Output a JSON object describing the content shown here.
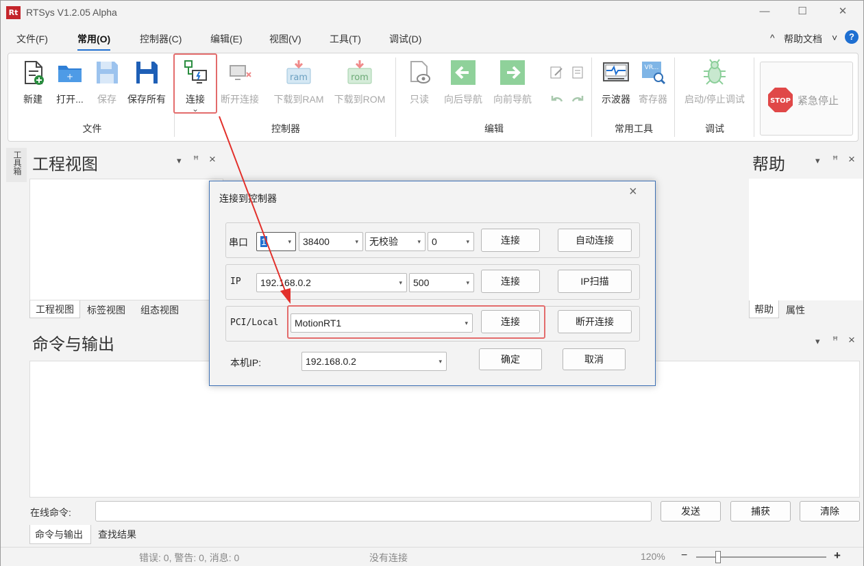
{
  "app": {
    "title": "RTSys V1.2.05 Alpha",
    "logo_text": "Rt"
  },
  "menu": {
    "items": [
      "文件(F)",
      "常用(O)",
      "控制器(C)",
      "编辑(E)",
      "视图(V)",
      "工具(T)",
      "调试(D)"
    ],
    "collapse": "^",
    "help_docs": "帮助文档",
    "help_arrow": "˅",
    "help_icon": "?"
  },
  "ribbon": {
    "file": {
      "group": "文件",
      "new": "新建",
      "open": "打开...",
      "save": "保存",
      "save_all": "保存所有"
    },
    "controller": {
      "group": "控制器",
      "connect": "连接",
      "connect_arrow": "⌄",
      "disconnect": "断开连接",
      "download_ram": "下载到RAM",
      "download_rom": "下载到ROM",
      "ram_label": "ram",
      "rom_label": "rom"
    },
    "edit": {
      "group": "编辑",
      "readonly": "只读",
      "nav_back": "向后导航",
      "nav_forward": "向前导航"
    },
    "tools": {
      "group": "常用工具",
      "oscilloscope": "示波器",
      "register": "寄存器",
      "vr_label": "VR..."
    },
    "debug": {
      "group": "调试",
      "start_stop": "启动/停止调试"
    },
    "emergency": {
      "label": "紧急停止",
      "stop_text": "STOP"
    }
  },
  "left_strip": "工具箱",
  "project": {
    "title": "工程视图",
    "tabs": [
      "工程视图",
      "标签视图",
      "组态视图"
    ]
  },
  "help_panel": {
    "title": "帮助",
    "tabs": [
      "帮助",
      "属性"
    ]
  },
  "output": {
    "title": "命令与输出",
    "online_label": "在线命令:",
    "online_value": "",
    "send": "发送",
    "capture": "捕获",
    "clear": "清除",
    "tabs": [
      "命令与输出",
      "查找结果"
    ]
  },
  "panel_controls": {
    "menu": "▾",
    "pin": "ᵖ",
    "close": "×"
  },
  "dialog": {
    "title": "连接到控制器",
    "close": "×",
    "serial": {
      "label": "串口",
      "port": "1",
      "baud": "38400",
      "parity": "无校验",
      "extra": "0",
      "connect": "连接",
      "auto_connect": "自动连接"
    },
    "ip": {
      "label": "IP",
      "address": "192.168.0.2",
      "port": "500",
      "connect": "连接",
      "scan": "IP扫描"
    },
    "pci": {
      "label": "PCI/Local",
      "value": "MotionRT1",
      "connect": "连接",
      "disconnect": "断开连接"
    },
    "local_ip": {
      "label": "本机IP:",
      "value": "192.168.0.2"
    },
    "ok": "确定",
    "cancel": "取消"
  },
  "status": {
    "messages": "错误: 0, 警告: 0, 消息: 0",
    "connection": "没有连接",
    "zoom": "120%",
    "minus": "−",
    "plus": "+"
  },
  "colors": {
    "accent": "#1e6fd1",
    "highlight": "#e36b6b",
    "arrow": "#e2302b",
    "dialog_border": "#3b6fb4"
  }
}
